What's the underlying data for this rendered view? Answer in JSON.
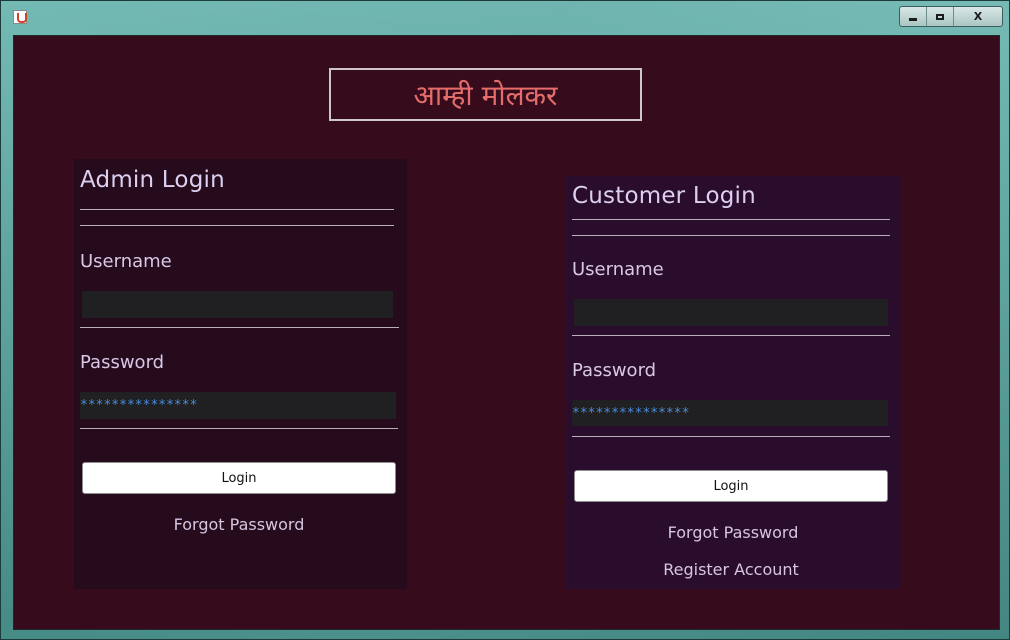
{
  "window": {
    "title": "",
    "controls": {
      "minimize": "",
      "maximize": "",
      "close": "X"
    }
  },
  "app_title": "आम्ही मोलकर",
  "admin": {
    "heading": "Admin Login",
    "username_label": "Username",
    "username_value": "",
    "password_label": "Password",
    "password_value": "***************",
    "login_label": "Login",
    "forgot_label": "Forgot Password"
  },
  "customer": {
    "heading": "Customer Login",
    "username_label": "Username",
    "username_value": "",
    "password_label": "Password",
    "password_value": "***************",
    "login_label": "Login",
    "forgot_label": "Forgot Password",
    "register_label": "Register Account"
  },
  "colors": {
    "client_bg": "#360c1c",
    "admin_panel_bg": "#250b1c",
    "customer_panel_bg": "#2a0c2c",
    "title_text": "#e46c6a",
    "password_mask": "#4a8cd8"
  }
}
